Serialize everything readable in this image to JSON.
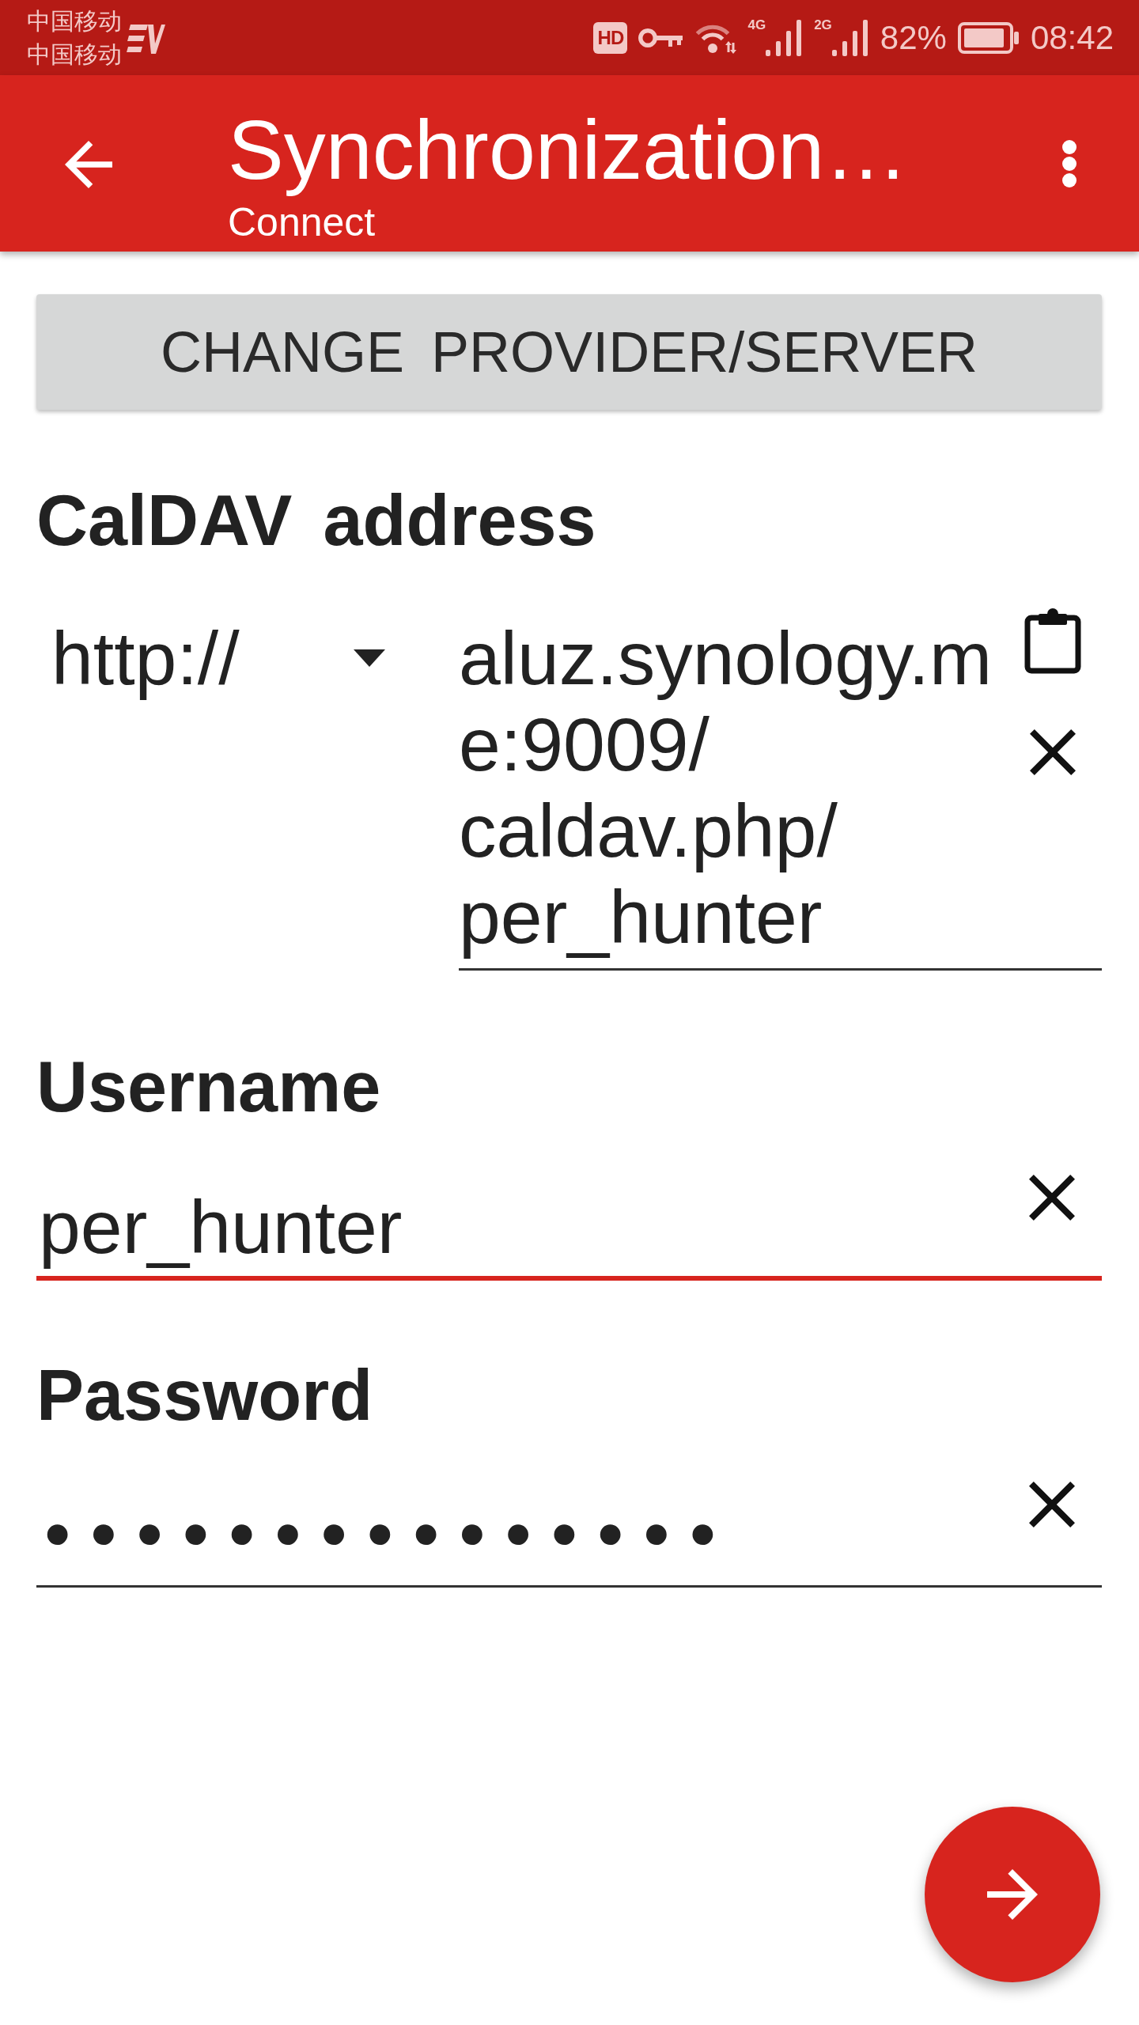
{
  "status_bar": {
    "carriers": [
      "中国移动",
      "中国移动"
    ],
    "hd_badge": "HD",
    "networks": [
      {
        "label": "4G"
      },
      {
        "label": "2G"
      }
    ],
    "battery": "82%",
    "time": "08:42"
  },
  "toolbar": {
    "title": "Synchronization…",
    "subtitle": "Connect"
  },
  "change_provider_button": "CHANGE PROVIDER/SERVER",
  "caldav_address": {
    "label": "CalDAV address",
    "scheme": "http://",
    "value": "aluz.synology.me:9009/caldav.php/per_hunter",
    "focused": false
  },
  "username": {
    "label": "Username",
    "value": "per_hunter",
    "focused": true
  },
  "password": {
    "label": "Password",
    "value": "•••••••••••••••",
    "focused": false
  }
}
